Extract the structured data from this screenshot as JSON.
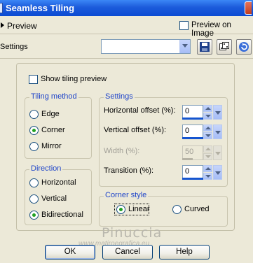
{
  "window": {
    "title": "Seamless Tiling"
  },
  "preview": {
    "label": "Preview",
    "preview_on_image_label": "Preview on Image",
    "preview_on_image_checked": false
  },
  "settings_bar": {
    "label": "Settings",
    "preset_value": "",
    "icons": [
      "save-icon",
      "randomize-dice-icon",
      "reset-icon"
    ]
  },
  "options": {
    "show_tiling_preview_label": "Show tiling preview",
    "show_tiling_preview_checked": false
  },
  "tiling_method": {
    "title": "Tiling method",
    "options": [
      "Edge",
      "Corner",
      "Mirror"
    ],
    "selected": "Corner"
  },
  "direction": {
    "title": "Direction",
    "options": [
      "Horizontal",
      "Vertical",
      "Bidirectional"
    ],
    "selected": "Bidirectional"
  },
  "settings_group": {
    "title": "Settings",
    "horizontal_offset": {
      "label": "Horizontal offset (%):",
      "value": "0",
      "enabled": true
    },
    "vertical_offset": {
      "label": "Vertical offset (%):",
      "value": "0",
      "enabled": true
    },
    "width": {
      "label": "Width (%):",
      "value": "50",
      "enabled": false
    },
    "transition": {
      "label": "Transition (%):",
      "value": "0",
      "enabled": true
    }
  },
  "corner_style": {
    "title": "Corner style",
    "options": [
      "Linear",
      "Curved"
    ],
    "selected": "Linear"
  },
  "watermark": {
    "name": "Pinuccia",
    "url": "www.matiroegrafica.eu"
  },
  "buttons": {
    "ok": "OK",
    "cancel": "Cancel",
    "help": "Help"
  },
  "colors": {
    "title_bar": "#0b4bd3",
    "group_title": "#1f45c9",
    "radio_dot": "#21a121",
    "dialog_bg": "#ece9d8"
  }
}
